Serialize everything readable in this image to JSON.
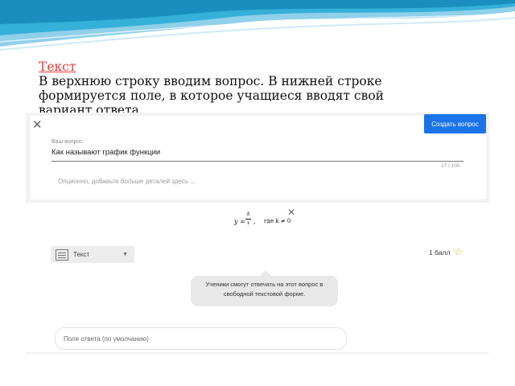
{
  "slide": {
    "title": "Текст",
    "body": "В верхнюю строку вводим вопрос. В нижней строке формируется поле, в которое учащиеся вводят свой вариант ответа"
  },
  "editor": {
    "create_button": "Создать вопрос",
    "question_label": "Ваш вопрос",
    "question_value": "Как называют график функции",
    "char_counter": "27 / 100",
    "description_placeholder": "Опционно, добавьте больше деталей здесь ...",
    "formula": {
      "y": "y =",
      "k": "k",
      "x": "x",
      "cond": "где k ≠ 0"
    },
    "answer_type": "Текст",
    "points": "1 балл",
    "info_text": "Ученики смогут отвечать на этот вопрос в свободной текстовой форме.",
    "default_field": "Поле ответа (по умолчанию)"
  },
  "colors": {
    "accent": "#1a73e8",
    "title_red": "#e53935",
    "star": "#f2b705",
    "wave_dark": "#1fa2cc",
    "wave_light": "#a9dbee"
  }
}
